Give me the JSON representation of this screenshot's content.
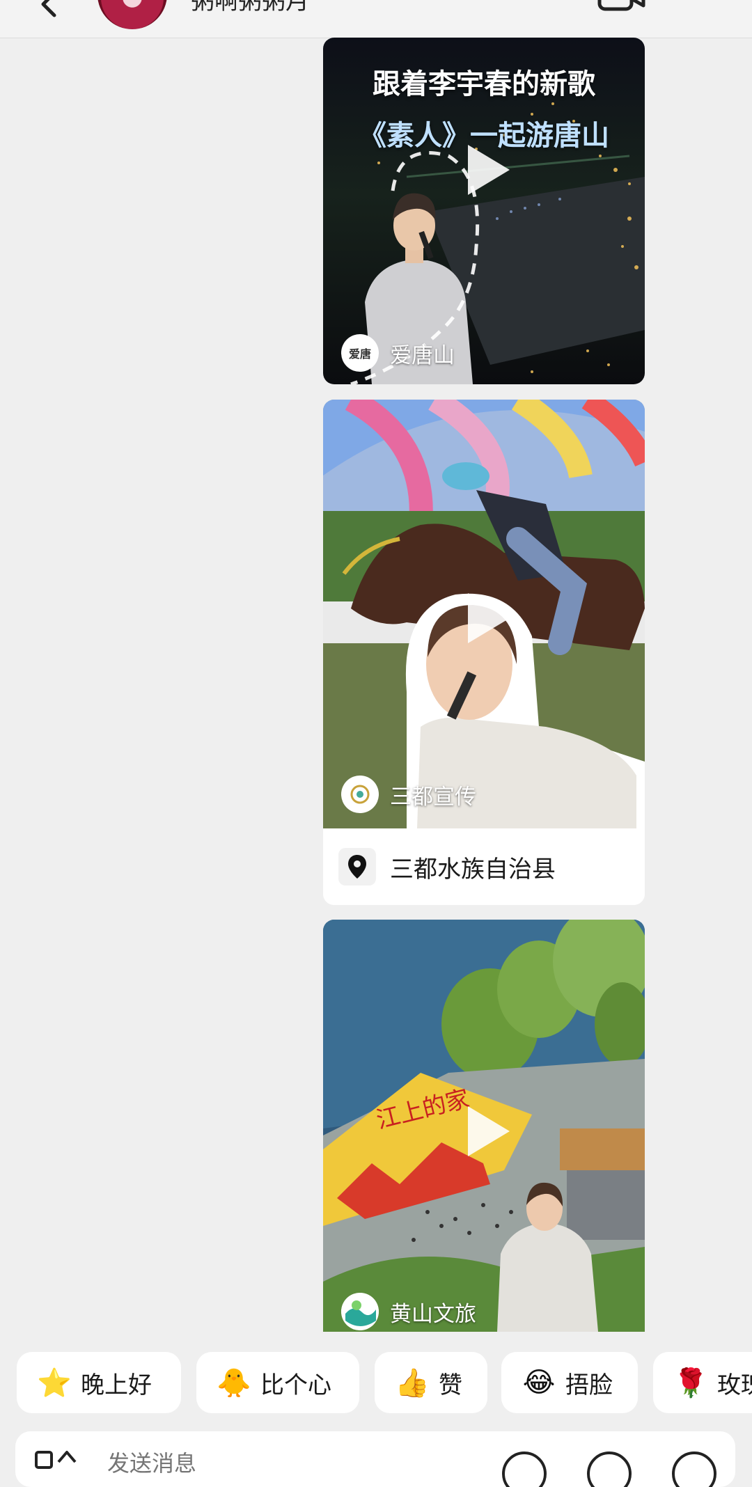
{
  "header": {
    "title": "粥啊粥粥月",
    "back_icon": "chevron-left-icon",
    "call_icon": "video-call-icon"
  },
  "videos": [
    {
      "overlay_line1": "跟着李宇春的新歌",
      "overlay_line2": "《素人》一起游唐山",
      "source_name": "爱唐山",
      "source_avatar_text": "爱唐",
      "play_icon": "play-icon"
    },
    {
      "source_name": "三都宣传",
      "location_icon": "map-pin-icon",
      "location": "三都水族自治县",
      "play_icon": "play-icon"
    },
    {
      "source_name": "黄山文旅",
      "banner_text": "江上的家",
      "play_icon": "play-icon"
    }
  ],
  "quick_replies": [
    {
      "emoji": "⭐",
      "label": "晚上好"
    },
    {
      "emoji": "🐥",
      "label": "比个心"
    },
    {
      "emoji": "👍",
      "label": "赞"
    },
    {
      "emoji": "😂",
      "label": "捂脸"
    },
    {
      "emoji": "🌹",
      "label": "玫瑰"
    }
  ],
  "input": {
    "placeholder": "发送消息"
  },
  "colors": {
    "background": "#efefef",
    "card": "#ffffff"
  }
}
